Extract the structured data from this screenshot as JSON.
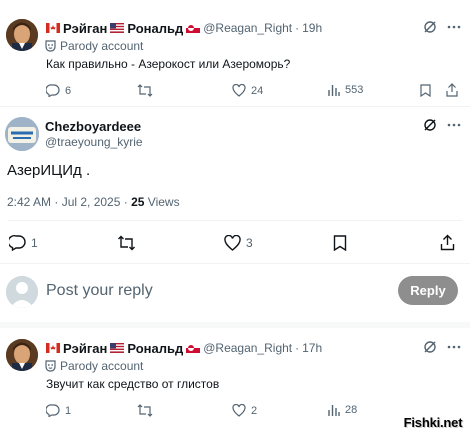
{
  "tweet1": {
    "name": "Рэйган",
    "name2": "Рональд",
    "handle": "@Reagan_Right",
    "dot": "·",
    "time": "19h",
    "parody": "Parody account",
    "text": "Как правильно - Азерокост или Азероморь?",
    "replies": "6",
    "likes": "24",
    "views": "553"
  },
  "main": {
    "name": "Chezboyardeee",
    "handle": "@traeyoung_kyrie",
    "text": "АзерИЦИд .",
    "time": "2:42 AM · Jul 2, 2025 ·",
    "views_count": "25",
    "views_label": "Views",
    "replies": "1",
    "likes": "3"
  },
  "composer": {
    "placeholder": "Post your reply",
    "button": "Reply"
  },
  "tweet2": {
    "name": "Рэйган",
    "name2": "Рональд",
    "handle": "@Reagan_Right",
    "dot": "·",
    "time": "17h",
    "parody": "Parody account",
    "text": "Звучит как средство от глистов",
    "replies": "1",
    "likes": "2",
    "views": "28"
  },
  "watermark": "Fishki.net",
  "colors": {
    "text": "#0f1419",
    "muted": "#536471",
    "reply_button": "#8e8e8e"
  }
}
